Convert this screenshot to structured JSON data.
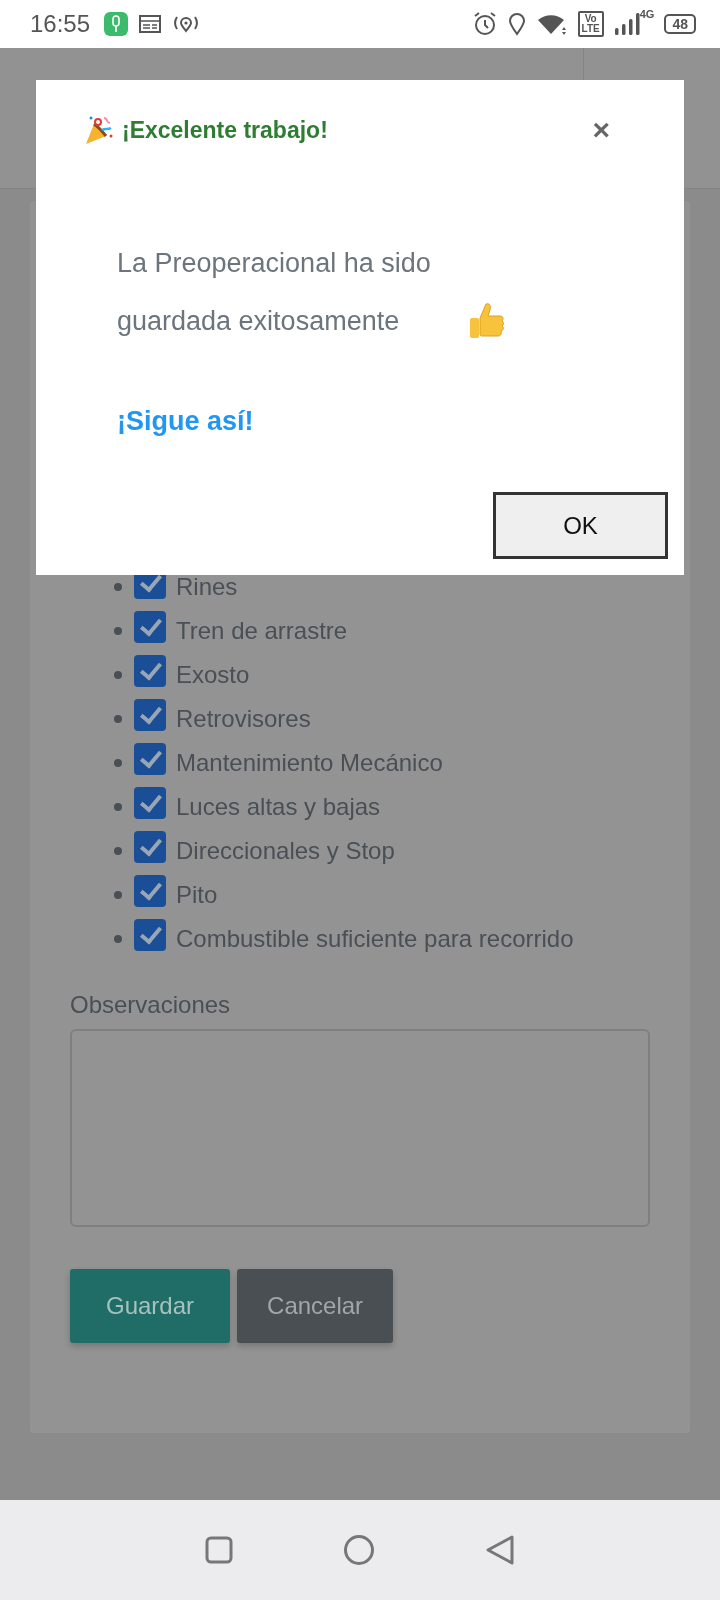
{
  "status_bar": {
    "time": "16:55",
    "volte": [
      "Vo",
      "LTE"
    ],
    "network": "4G",
    "battery": "48"
  },
  "checklist": [
    {
      "label": "Rines",
      "checked": true
    },
    {
      "label": "Tren de arrastre",
      "checked": true
    },
    {
      "label": "Exosto",
      "checked": true
    },
    {
      "label": "Retrovisores",
      "checked": true
    },
    {
      "label": "Mantenimiento Mecánico",
      "checked": true
    },
    {
      "label": "Luces altas y bajas",
      "checked": true
    },
    {
      "label": "Direccionales y Stop",
      "checked": true
    },
    {
      "label": "Pito",
      "checked": true
    },
    {
      "label": "Combustible suficiente para recorrido",
      "checked": true
    }
  ],
  "observations": {
    "label": "Observaciones"
  },
  "buttons": [
    {
      "label": "Guardar",
      "kind": "primary"
    },
    {
      "label": "Cancelar",
      "kind": "secondary"
    }
  ],
  "dialog": {
    "title": "¡Excelente trabajo!",
    "close": "×",
    "message": "La Preoperacional ha sido guardada exitosamente",
    "emphasis": "¡Sigue así!",
    "ok": "OK"
  }
}
